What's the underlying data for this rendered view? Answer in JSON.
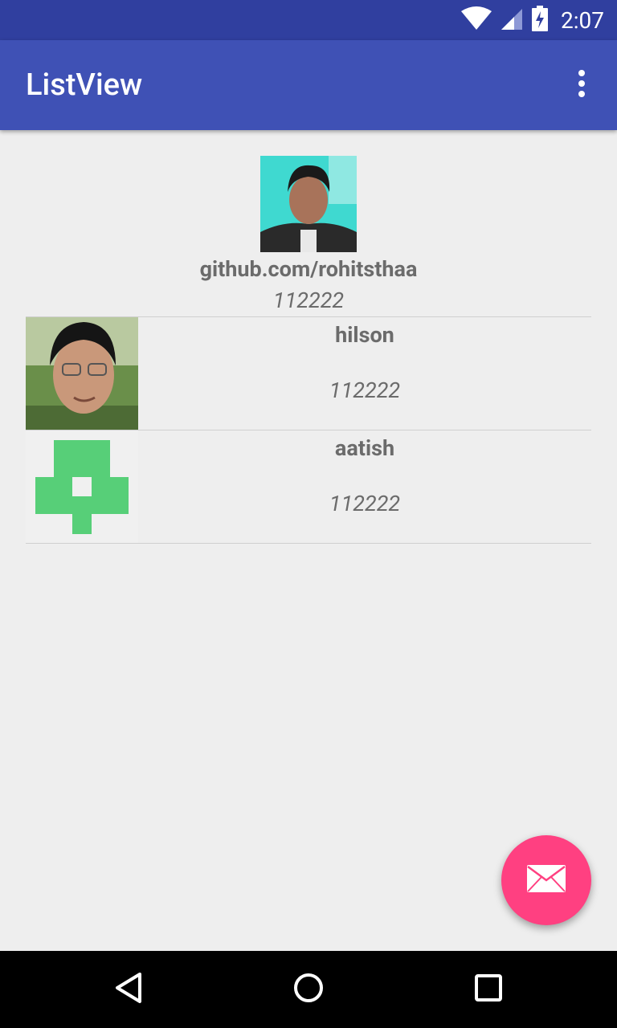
{
  "status_bar": {
    "time": "2:07",
    "icons": [
      "wifi-icon",
      "cell-signal-icon",
      "battery-charging-icon"
    ],
    "color": "#303f9f"
  },
  "app_bar": {
    "title": "ListView",
    "menu_icon": "more-vert-icon",
    "color": "#3f51b5"
  },
  "header": {
    "name": "github.com/rohitsthaa",
    "number": "112222",
    "avatar": "profile-photo"
  },
  "list": {
    "items": [
      {
        "name": "hilson",
        "number": "112222",
        "avatar": "profile-photo"
      },
      {
        "name": "aatish",
        "number": "112222",
        "avatar": "identicon"
      }
    ]
  },
  "fab": {
    "icon": "mail-icon",
    "color": "#ff4081"
  },
  "nav_bar": {
    "buttons": [
      "back-icon",
      "home-icon",
      "recents-icon"
    ]
  }
}
